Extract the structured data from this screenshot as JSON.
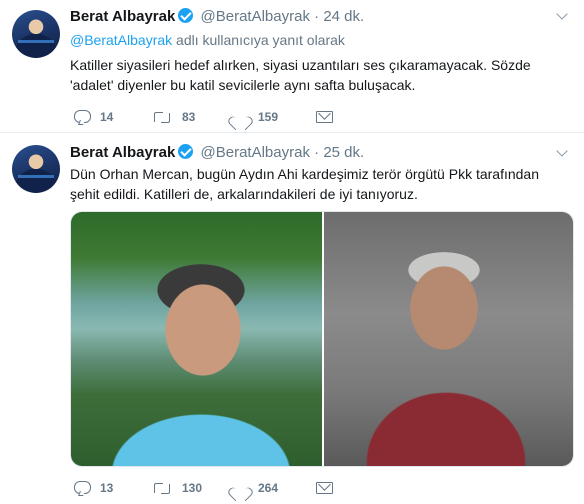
{
  "tweets": [
    {
      "author_name": "Berat Albayrak",
      "author_handle": "@BeratAlbayrak",
      "separator": "·",
      "time": "24 dk.",
      "reply_to_handle": "@BeratAlbayrak",
      "reply_to_suffix": " adlı kullanıcıya yanıt olarak",
      "text": "Katiller siyasileri hedef alırken, siyasi uzantıları ses çıkaramayacak. Sözde 'adalet' diyenler bu katil sevicilerle aynı safta buluşacak.",
      "reply_count": "14",
      "retweet_count": "83",
      "like_count": "159"
    },
    {
      "author_name": "Berat Albayrak",
      "author_handle": "@BeratAlbayrak",
      "separator": "·",
      "time": "25 dk.",
      "text": "Dün Orhan Mercan, bugün Aydın Ahi kardeşimiz terör örgütü Pkk tarafından şehit edildi. Katilleri de, arkalarındakileri de iyi tanıyoruz.",
      "reply_count": "13",
      "retweet_count": "130",
      "like_count": "264"
    }
  ],
  "icons": {
    "verified": "verified-badge-icon",
    "caret": "chevron-down-icon",
    "reply": "reply-icon",
    "retweet": "retweet-icon",
    "like": "heart-icon",
    "dm": "envelope-icon"
  },
  "colors": {
    "accent": "#1da1f2",
    "muted": "#657786",
    "text": "#14171a"
  }
}
